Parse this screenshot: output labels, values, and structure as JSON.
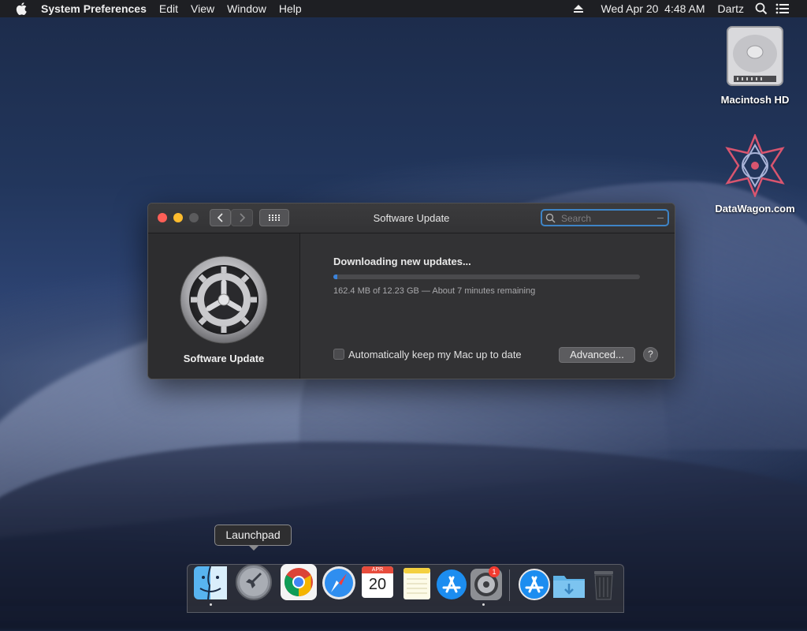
{
  "menubar": {
    "app_name": "System Preferences",
    "menus": [
      "Edit",
      "View",
      "Window",
      "Help"
    ],
    "datetime": "Wed Apr 20  4:48 AM",
    "user": "Dartz"
  },
  "desktop": {
    "icons": [
      {
        "label": "Macintosh HD"
      },
      {
        "label": "DataWagon.com"
      }
    ]
  },
  "window": {
    "title": "Software Update",
    "search_placeholder": "Search",
    "pane_label": "Software Update",
    "status": "Downloading new updates...",
    "progress": 0.0133,
    "detail": "162.4 MB of 12.23 GB — About 7 minutes remaining",
    "auto_update_label": "Automatically keep my Mac up to date",
    "auto_update_checked": false,
    "advanced_label": "Advanced...",
    "help_label": "?"
  },
  "tooltip": {
    "text": "Launchpad"
  },
  "dock": {
    "apps": [
      "finder",
      "launchpad",
      "chrome",
      "safari",
      "calendar",
      "notes",
      "app-store",
      "system-preferences",
      "app-store-downloads",
      "downloads-folder",
      "trash"
    ],
    "calendar_month": "APR",
    "calendar_day": "20",
    "badge": "1"
  },
  "colors": {
    "accent": "#3b82d9",
    "close": "#fe5f57",
    "minimize": "#febc2e"
  }
}
